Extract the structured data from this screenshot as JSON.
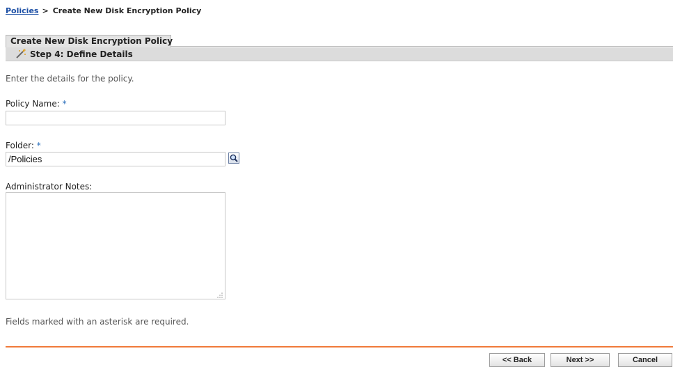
{
  "breadcrumb": {
    "root_link": "Policies",
    "separator": ">",
    "current": "Create New Disk Encryption Policy"
  },
  "wizard": {
    "title": "Create New Disk Encryption Policy",
    "step_icon": "wizard-wand-icon",
    "step_label": "Step 4: Define Details",
    "intro": "Enter the details for the policy."
  },
  "form": {
    "policy_name": {
      "label": "Policy Name:",
      "required_mark": "*",
      "value": ""
    },
    "folder": {
      "label": "Folder:",
      "required_mark": "*",
      "value": "/Policies",
      "browse_icon": "magnifier-icon"
    },
    "notes": {
      "label": "Administrator Notes:",
      "value": ""
    },
    "footnote": "Fields marked with an asterisk are required."
  },
  "buttons": {
    "back": "<< Back",
    "next": "Next >>",
    "cancel": "Cancel"
  },
  "colors": {
    "link": "#1c4fa5",
    "required": "#2a6ebb",
    "divider": "#f07a3a",
    "step_bar": "#dcdcdc"
  }
}
